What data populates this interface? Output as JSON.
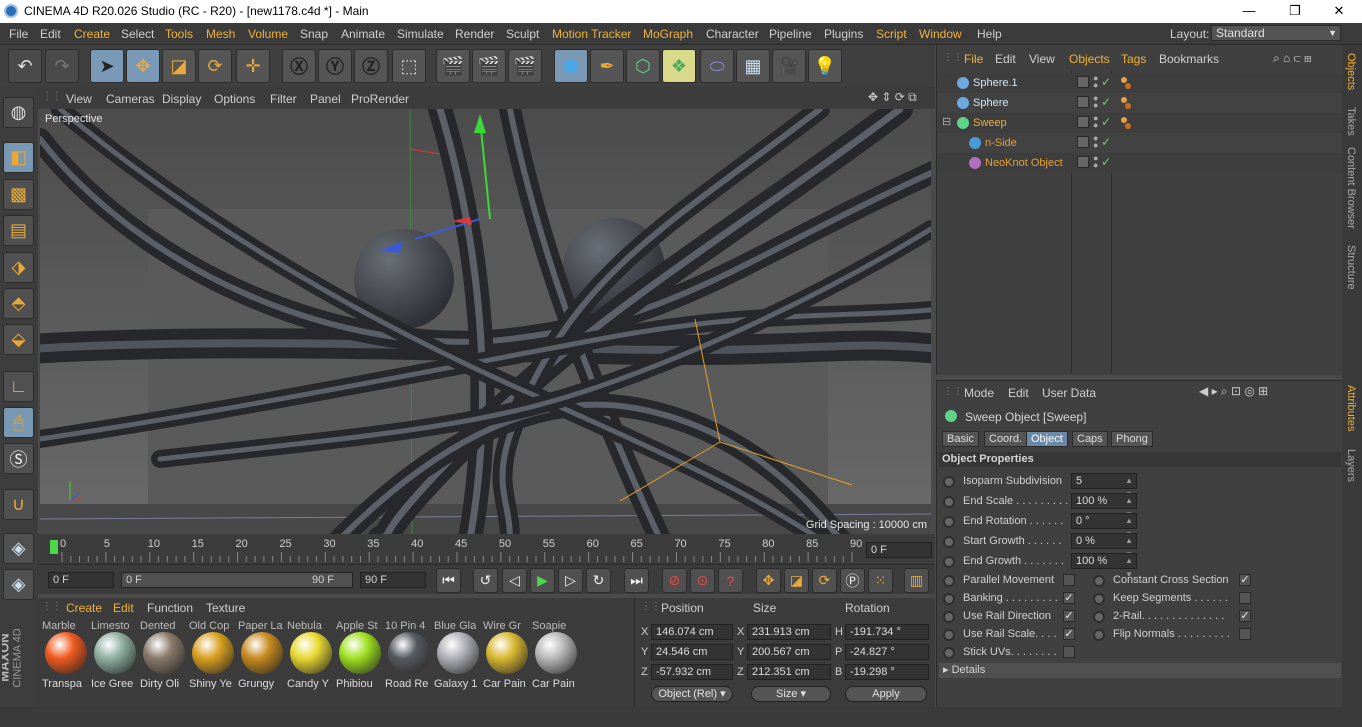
{
  "window": {
    "title": "CINEMA 4D R20.026 Studio (RC - R20) - [new1178.c4d *] - Main",
    "minimize": "—",
    "maximize": "❐",
    "close": "✕"
  },
  "menu": {
    "items": [
      "File",
      "Edit",
      "Create",
      "Select",
      "Tools",
      "Mesh",
      "Volume",
      "Snap",
      "Animate",
      "Simulate",
      "Render",
      "Sculpt",
      "Motion Tracker",
      "MoGraph",
      "Character",
      "Pipeline",
      "Plugins",
      "Script",
      "Window",
      "Help"
    ],
    "highlighted": [
      "Create",
      "Tools",
      "Mesh",
      "Volume",
      "Motion Tracker",
      "MoGraph",
      "Script",
      "Window"
    ],
    "layout_label": "Layout:",
    "layout_value": "Standard"
  },
  "viewport": {
    "menu": [
      "View",
      "Cameras",
      "Display",
      "Options",
      "Filter",
      "Panel",
      "ProRender"
    ],
    "camera_label": "Perspective",
    "grid_spacing": "Grid Spacing : 10000 cm"
  },
  "timeline": {
    "ticks": [
      "0",
      "5",
      "10",
      "15",
      "20",
      "25",
      "30",
      "35",
      "40",
      "45",
      "50",
      "55",
      "60",
      "65",
      "70",
      "75",
      "80",
      "85",
      "90"
    ],
    "current_frame": "0 F"
  },
  "playback": {
    "start": "0 F",
    "range_start": "0 F",
    "range_end": "90 F",
    "end": "90 F"
  },
  "materials": {
    "menu": [
      "Create",
      "Edit",
      "Function",
      "Texture"
    ],
    "top_row_names": [
      "Marble",
      "Limesto",
      "Dented",
      "Old Cop",
      "Paper La",
      "Nebula",
      "Apple St",
      "10 Pin 4",
      "Blue Gla",
      "Wire Gr",
      "Soapie"
    ],
    "items": [
      {
        "name": "Transpa",
        "color": "#f05a1e"
      },
      {
        "name": "Ice Gree",
        "color": "#8fb0a0"
      },
      {
        "name": "Dirty Oli",
        "color": "#8a7a6a"
      },
      {
        "name": "Shiny Ye",
        "color": "#d8a020"
      },
      {
        "name": "Grungy",
        "color": "#c88a20"
      },
      {
        "name": "Candy Y",
        "color": "#e8d830"
      },
      {
        "name": "Phibiou",
        "color": "#9ee020"
      },
      {
        "name": "Road Re",
        "color": "#555a60"
      },
      {
        "name": "Galaxy 1",
        "color": "#b0b0b8"
      },
      {
        "name": "Car Pain",
        "color": "#d8b830"
      },
      {
        "name": "Car Pain",
        "color": "#b8b8b8"
      }
    ]
  },
  "coordinates": {
    "headers": {
      "position": "Position",
      "size": "Size",
      "rotation": "Rotation"
    },
    "rows": [
      {
        "axis": "X",
        "pos": "146.074 cm",
        "size_axis": "X",
        "size": "231.913 cm",
        "rot_axis": "H",
        "rot": "-191.734 °"
      },
      {
        "axis": "Y",
        "pos": "24.546 cm",
        "size_axis": "Y",
        "size": "200.567 cm",
        "rot_axis": "P",
        "rot": "-24.827 °"
      },
      {
        "axis": "Z",
        "pos": "-57.932 cm",
        "size_axis": "Z",
        "size": "212.351 cm",
        "rot_axis": "B",
        "rot": "-19.298 °"
      }
    ],
    "mode": "Object (Rel)",
    "size_mode": "Size",
    "apply": "Apply"
  },
  "objects": {
    "menu": [
      "File",
      "Edit",
      "View",
      "Objects",
      "Tags",
      "Bookmarks"
    ],
    "highlighted": [
      "File",
      "Objects",
      "Tags"
    ],
    "rows": [
      {
        "name": "Sphere.1",
        "color": "#cfe6ff",
        "indent": 0,
        "icon": "#6fa8e0"
      },
      {
        "name": "Sphere",
        "color": "#cfe6ff",
        "indent": 0,
        "icon": "#6fa8e0"
      },
      {
        "name": "Sweep",
        "color": "#f2b233",
        "indent": 0,
        "icon": "#5fd38a"
      },
      {
        "name": "n-Side",
        "color": "#e8a030",
        "indent": 1,
        "icon": "#4a9ad8"
      },
      {
        "name": "NeoKnot Object",
        "color": "#e8a030",
        "indent": 1,
        "icon": "#b070c0"
      }
    ]
  },
  "attributes": {
    "menu": [
      "Mode",
      "Edit",
      "User Data"
    ],
    "object_title": "Sweep Object [Sweep]",
    "tabs": [
      "Basic",
      "Coord.",
      "Object",
      "Caps",
      "Phong"
    ],
    "active_tab": "Object",
    "section": "Object Properties",
    "props": [
      {
        "label": "Isoparm Subdivision",
        "value": "5"
      },
      {
        "label": "End Scale . . . . . . . . .",
        "value": "100 %"
      },
      {
        "label": "End Rotation . . . . . .",
        "value": "0 °"
      },
      {
        "label": "Start Growth . . . . . .",
        "value": "0 %"
      },
      {
        "label": "End Growth . . . . . . .",
        "value": "100 %"
      }
    ],
    "checks_left": [
      {
        "label": "Parallel Movement",
        "checked": false
      },
      {
        "label": "Banking . . . . . . . . .",
        "checked": true
      },
      {
        "label": "Use Rail Direction",
        "checked": true
      },
      {
        "label": "Use Rail Scale. . . .",
        "checked": true
      },
      {
        "label": "Stick UVs. . . . . . . .",
        "checked": false
      }
    ],
    "checks_right": [
      {
        "label": "Constant Cross Section",
        "checked": true
      },
      {
        "label": "Keep Segments . . . . . .",
        "checked": false
      },
      {
        "label": "2-Rail. . . . . . . . . . . . . .",
        "checked": true
      },
      {
        "label": "Flip Normals . . . . . . . . .",
        "checked": false
      }
    ],
    "details": "Details"
  },
  "side_tabs": [
    "Objects",
    "Takes",
    "Content Browser",
    "Structure",
    "Attributes",
    "Layers"
  ],
  "branding": {
    "maxon": "MAXON",
    "cinema": "CINEMA 4D"
  }
}
